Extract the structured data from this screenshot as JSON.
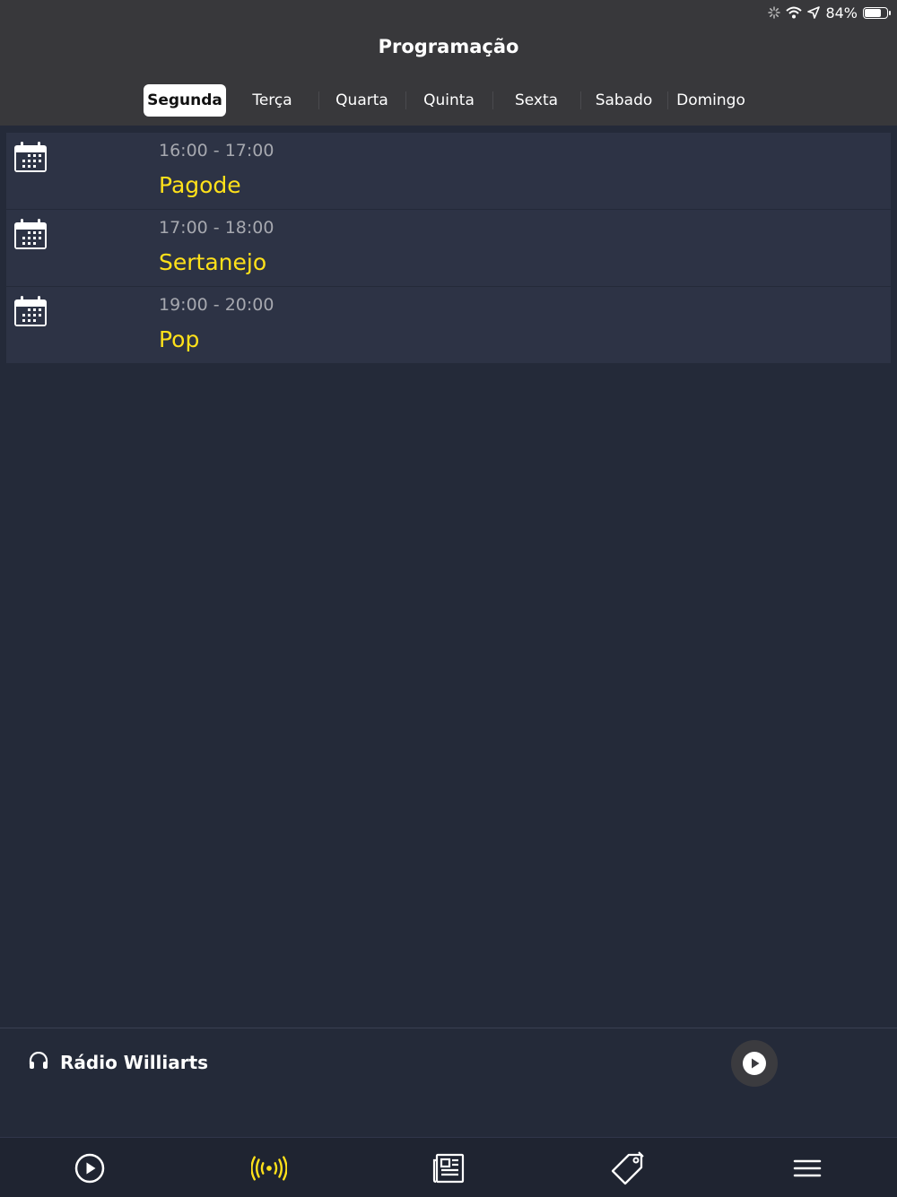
{
  "status_bar": {
    "battery_percent": "84%",
    "battery_level": 0.84,
    "icons": [
      "activity-spinner-icon",
      "wifi-icon",
      "location-arrow-icon",
      "battery-icon"
    ]
  },
  "header": {
    "title": "Programação"
  },
  "tabs": [
    {
      "label": "Segunda",
      "active": true
    },
    {
      "label": "Terça",
      "active": false
    },
    {
      "label": "Quarta",
      "active": false
    },
    {
      "label": "Quinta",
      "active": false
    },
    {
      "label": "Sexta",
      "active": false
    },
    {
      "label": "Sabado",
      "active": false
    },
    {
      "label": "Domingo",
      "active": false
    }
  ],
  "schedule": [
    {
      "time": "16:00 - 17:00",
      "name": "Pagode",
      "icon": "calendar-icon"
    },
    {
      "time": "17:00 - 18:00",
      "name": "Sertanejo",
      "icon": "calendar-icon"
    },
    {
      "time": "19:00 - 20:00",
      "name": "Pop",
      "icon": "calendar-icon"
    }
  ],
  "player": {
    "station": "Rádio Williarts",
    "icon": "headphones-icon",
    "button_icon": "play-icon"
  },
  "tabbar": [
    {
      "icon": "play-circle-icon",
      "active": false
    },
    {
      "icon": "radio-broadcast-icon",
      "active": true
    },
    {
      "icon": "newspaper-icon",
      "active": false
    },
    {
      "icon": "tag-icon",
      "active": false
    },
    {
      "icon": "menu-icon",
      "active": false
    }
  ],
  "colors": {
    "accent": "#ffe11a",
    "background": "#242a39",
    "header": "#38383b",
    "row": "#2d3345"
  }
}
